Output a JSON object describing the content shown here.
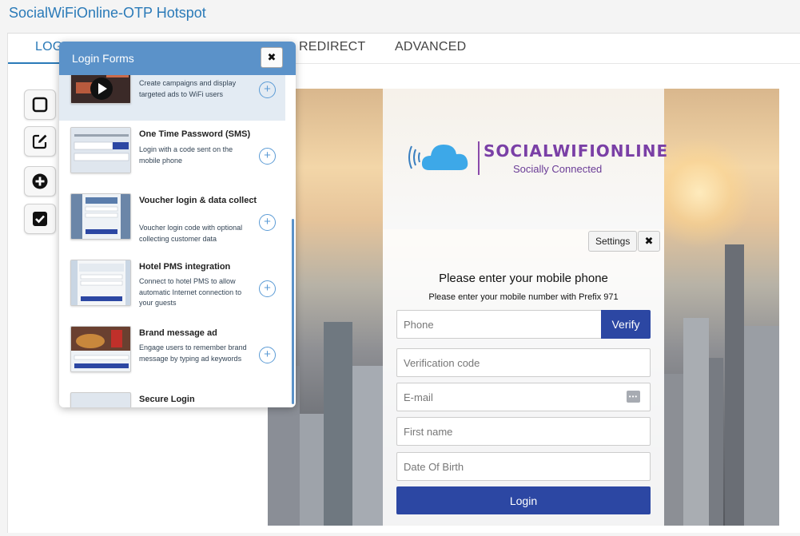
{
  "app": {
    "title": "SocialWiFiOnline-OTP Hotspot"
  },
  "tabs": [
    {
      "label": "LOGIN"
    },
    {
      "label": "REDIRECT"
    },
    {
      "label": "ADVANCED"
    }
  ],
  "toolbar": {
    "buttons": [
      "square-outline-icon",
      "edit-icon",
      "plus-circle-icon",
      "checkbox-icon"
    ]
  },
  "popover": {
    "title": "Login Forms",
    "close_label": "✖",
    "items": [
      {
        "title": "",
        "description": "Create campaigns and display targeted ads to WiFi users"
      },
      {
        "title": "One Time Password (SMS)",
        "description": "Login with a code sent on the mobile phone"
      },
      {
        "title": "Voucher login & data collect",
        "description": "Voucher login code with optional collecting customer data"
      },
      {
        "title": "Hotel PMS integration",
        "description": "Connect to hotel PMS to allow automatic Internet connection to your guests"
      },
      {
        "title": "Brand message ad",
        "description": "Engage users to remember brand message by typing ad keywords"
      },
      {
        "title": "Secure Login",
        "description": ""
      }
    ],
    "add_label": "+"
  },
  "preview": {
    "logo_text": "SOCIALWIFIONLINE",
    "logo_tagline": "Socially Connected",
    "settings_label": "Settings",
    "close_label": "✖",
    "form_title": "Please enter your mobile phone",
    "form_subtitle": "Please enter your mobile number with Prefix 971",
    "fields": {
      "phone_placeholder": "Phone",
      "verification_placeholder": "Verification code",
      "email_placeholder": "E-mail",
      "first_name_placeholder": "First name",
      "dob_placeholder": "Date Of Birth"
    },
    "verify_label": "Verify",
    "login_label": "Login"
  },
  "colors": {
    "accent": "#2a7ab8",
    "popover_header": "#5b92c9",
    "primary_button": "#2c47a3"
  }
}
